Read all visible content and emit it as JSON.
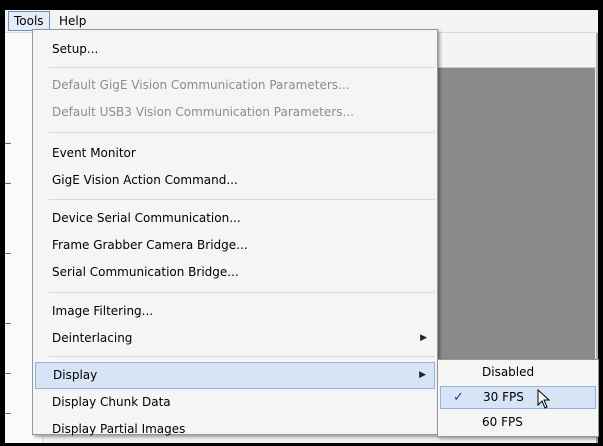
{
  "menubar": {
    "items": [
      {
        "label": "Tools"
      },
      {
        "label": "Help"
      }
    ]
  },
  "tools_menu": {
    "items": [
      {
        "label": "Setup..."
      },
      {
        "label": "Default GigE Vision Communication Parameters..."
      },
      {
        "label": "Default USB3 Vision Communication Parameters..."
      },
      {
        "label": "Event Monitor"
      },
      {
        "label": "GigE Vision Action Command..."
      },
      {
        "label": "Device Serial Communication..."
      },
      {
        "label": "Frame Grabber Camera Bridge..."
      },
      {
        "label": "Serial Communication Bridge..."
      },
      {
        "label": "Image Filtering..."
      },
      {
        "label": "Deinterlacing"
      },
      {
        "label": "Display"
      },
      {
        "label": "Display Chunk Data"
      },
      {
        "label": "Display Partial Images"
      }
    ]
  },
  "display_submenu": {
    "items": [
      {
        "label": "Disabled"
      },
      {
        "label": "30 FPS"
      },
      {
        "label": "60 FPS"
      }
    ],
    "checked": "30 FPS"
  },
  "icons": {
    "submenu_arrow": "chevron-right-icon",
    "check": "checkmark-icon",
    "cursor": "mouse-pointer-icon"
  }
}
